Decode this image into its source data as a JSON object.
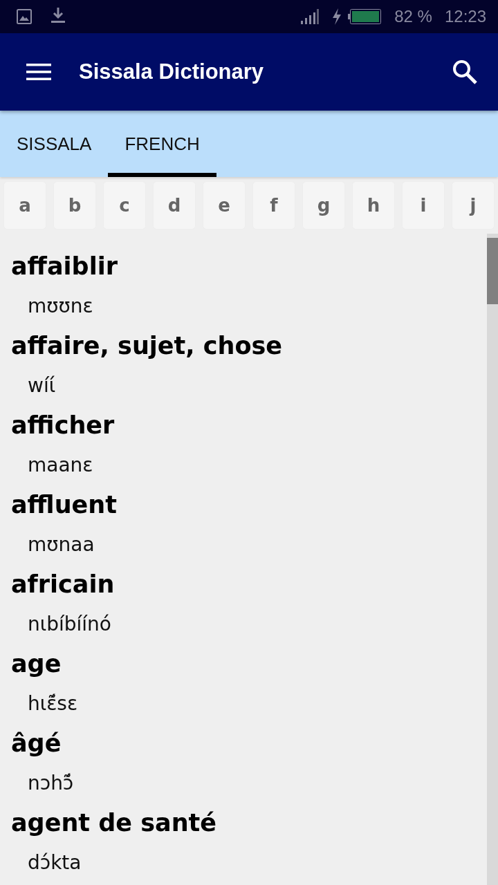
{
  "status_bar": {
    "battery": "82 %",
    "time": "12:23"
  },
  "app_bar": {
    "title": "Sissala Dictionary"
  },
  "tabs": [
    {
      "label": "SISSALA",
      "selected": false
    },
    {
      "label": "FRENCH",
      "selected": true
    }
  ],
  "alphabet": [
    "a",
    "b",
    "c",
    "d",
    "e",
    "f",
    "g",
    "h",
    "i",
    "j"
  ],
  "entries": [
    {
      "headword": "affaiblir",
      "translation": "mʊʊnɛ"
    },
    {
      "headword": "affaire, sujet, chose",
      "translation": "wíɩ́"
    },
    {
      "headword": "afficher",
      "translation": "maanɛ"
    },
    {
      "headword": "affluent",
      "translation": "mʊnaa"
    },
    {
      "headword": "africain",
      "translation": "nɩbíbíínó"
    },
    {
      "headword": "age",
      "translation": "hɩɛ̃́sɛ"
    },
    {
      "headword": "âgé",
      "translation": "nɔhɔ̃́"
    },
    {
      "headword": "agent de santé",
      "translation": "dɔ́kta"
    }
  ]
}
